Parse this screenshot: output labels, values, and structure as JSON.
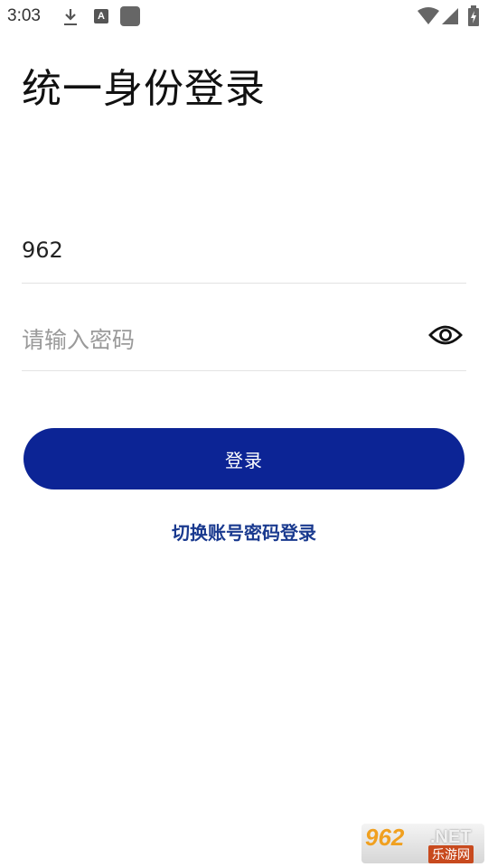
{
  "status_bar": {
    "time": "3:03",
    "icons": [
      "download-icon",
      "a-icon",
      "square-icon",
      "wifi-icon",
      "signal-icon",
      "battery-icon"
    ],
    "a_icon_text": "A"
  },
  "page": {
    "title": "统一身份登录"
  },
  "form": {
    "username_value": "962",
    "password_placeholder": "请输入密码",
    "login_label": "登录",
    "switch_link": "切换账号密码登录"
  },
  "watermark": {
    "main": "962",
    "net": ".NET",
    "sub": "乐游网"
  },
  "colors": {
    "primary": "#0c2495",
    "link": "#1a3a8f",
    "placeholder": "#9a9a9a",
    "divider": "#e3e3e3"
  }
}
